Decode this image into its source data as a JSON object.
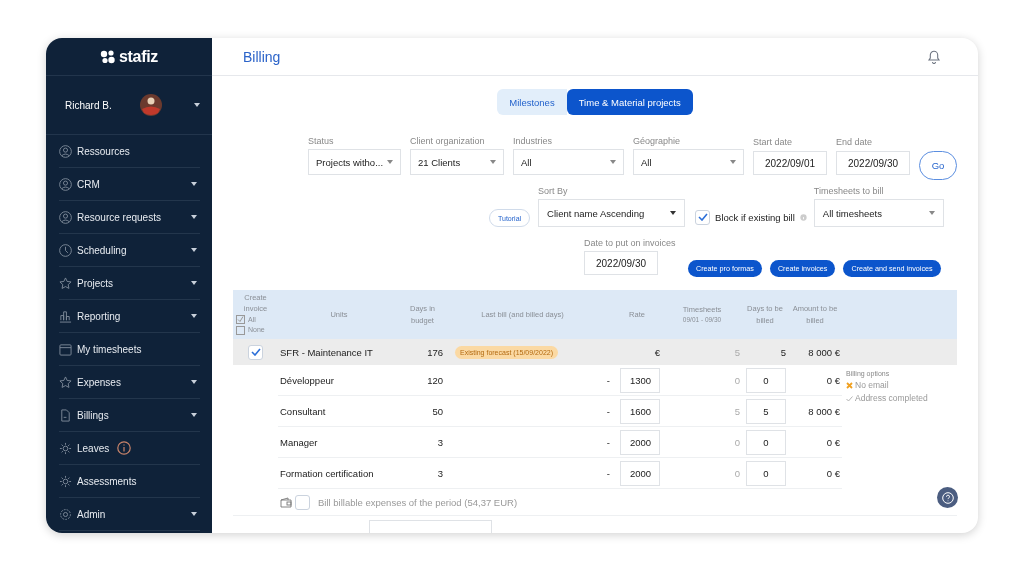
{
  "brand": {
    "name": "stafiz"
  },
  "user": {
    "name": "Richard B."
  },
  "nav": [
    {
      "label": "Ressources",
      "submenu": false,
      "info": false
    },
    {
      "label": "CRM",
      "submenu": true,
      "info": false
    },
    {
      "label": "Resource requests",
      "submenu": true,
      "info": false
    },
    {
      "label": "Scheduling",
      "submenu": true,
      "info": false
    },
    {
      "label": "Projects",
      "submenu": true,
      "info": false
    },
    {
      "label": "Reporting",
      "submenu": true,
      "info": false
    },
    {
      "label": "My timesheets",
      "submenu": false,
      "info": false
    },
    {
      "label": "Expenses",
      "submenu": true,
      "info": false
    },
    {
      "label": "Billings",
      "submenu": true,
      "info": false
    },
    {
      "label": "Leaves",
      "submenu": false,
      "info": true
    },
    {
      "label": "Assessments",
      "submenu": false,
      "info": false
    },
    {
      "label": "Admin",
      "submenu": true,
      "info": false
    }
  ],
  "page_title": "Billing",
  "tabs": [
    {
      "label": "Milestones",
      "selected": false
    },
    {
      "label": "Time & Material projects",
      "selected": true
    }
  ],
  "filters": [
    {
      "label": "Status",
      "value": "Projects witho...",
      "kind": "select"
    },
    {
      "label": "Client organization",
      "value": "21 Clients",
      "kind": "select"
    },
    {
      "label": "Industries",
      "value": "All",
      "kind": "select"
    },
    {
      "label": "Géographie",
      "value": "All",
      "kind": "select"
    },
    {
      "label": "Start date",
      "value": "2022/09/01",
      "kind": "date"
    },
    {
      "label": "End date",
      "value": "2022/09/30",
      "kind": "date"
    }
  ],
  "go_button": "Go",
  "tutorial_button": "Tutorial",
  "sort_by": {
    "label": "Sort By",
    "value": "Client name Ascending"
  },
  "block_existing": {
    "label": "Block if existing bill",
    "checked": true
  },
  "timesheets_to_bill": {
    "label": "Timesheets to bill",
    "value": "All timesheets"
  },
  "invoice_date": {
    "label": "Date to put on invoices",
    "value": "2022/09/30"
  },
  "actions": [
    "Create pro formas",
    "Create invoices",
    "Create and send invoices"
  ],
  "table": {
    "create_header": {
      "title": "Create invoice",
      "all": "All",
      "none": "None"
    },
    "columns": [
      "Units",
      "Days in budget",
      "Last bill (and billed days)",
      "Rate",
      "Timesheets",
      "Days to be billed",
      "Amount to be billed"
    ],
    "timesheets_period": "09/01 - 09/30",
    "group": {
      "checked": true,
      "name": "SFR - Maintenance IT",
      "days_in_budget": "176",
      "badge": "Existing forecast (15/09/2022)",
      "rate": "€",
      "timesheets": "5",
      "days_to_bill": "5",
      "amount": "8 000 €"
    },
    "rows": [
      {
        "unit": "Développeur",
        "days_in_budget": "120",
        "last_bill": "-",
        "rate": "1300",
        "timesheets": "0",
        "days_to_bill": "0",
        "amount": "0 €"
      },
      {
        "unit": "Consultant",
        "days_in_budget": "50",
        "last_bill": "-",
        "rate": "1600",
        "timesheets": "5",
        "days_to_bill": "5",
        "amount": "8 000 €"
      },
      {
        "unit": "Manager",
        "days_in_budget": "3",
        "last_bill": "-",
        "rate": "2000",
        "timesheets": "0",
        "days_to_bill": "0",
        "amount": "0 €"
      },
      {
        "unit": "Formation certification",
        "days_in_budget": "3",
        "last_bill": "-",
        "rate": "2000",
        "timesheets": "0",
        "days_to_bill": "0",
        "amount": "0 €"
      }
    ],
    "billing_options": {
      "title": "Billing options",
      "items": [
        {
          "label": "No email",
          "ok": false
        },
        {
          "label": "Address completed",
          "ok": true
        }
      ]
    },
    "expenses": {
      "checked": false,
      "label": "Bill billable expenses of the period (54,37 EUR)"
    }
  }
}
